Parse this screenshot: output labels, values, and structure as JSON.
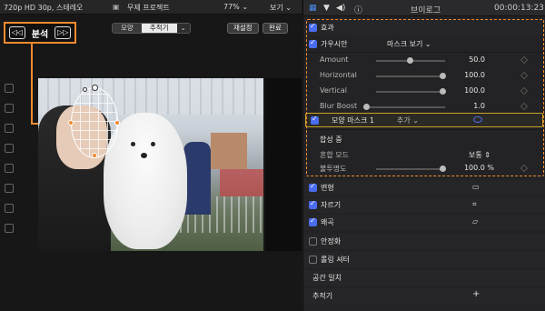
{
  "viewer": {
    "format": "720p HD 30p, 스테레오",
    "project": "무제 프로젝트",
    "zoom": "77%",
    "view": "보기",
    "segments": [
      "모양",
      "추적기"
    ],
    "active_segment": "추적기",
    "reset": "재설정",
    "done": "완료"
  },
  "analyze": {
    "back": "◁◁",
    "label": "분석",
    "forward": "▷▷"
  },
  "inspector": {
    "title": "브이로그",
    "timecode": "00:00:13:23",
    "effects_header": "효과",
    "gaussian": {
      "name": "가우시안",
      "mask_view": "마스크 보기"
    },
    "params": [
      {
        "label": "Amount",
        "value": "50.0",
        "level": 0.5
      },
      {
        "label": "Horizontal",
        "value": "100.0",
        "level": 1.0
      },
      {
        "label": "Vertical",
        "value": "100.0",
        "level": 1.0
      },
      {
        "label": "Blur Boost",
        "value": "1.0",
        "level": 0.05
      }
    ],
    "shape_mask": {
      "label": "모양 마스크 1",
      "add": "추가"
    },
    "composite": {
      "header": "합성 중",
      "blend_label": "혼합 모드",
      "blend_value": "보통",
      "opacity_label": "불투명도",
      "opacity_value": "100.0 %",
      "opacity_level": 1.0
    },
    "sections": [
      {
        "label": "변형",
        "checked": true,
        "icon": "transform-icon"
      },
      {
        "label": "자르기",
        "checked": true,
        "icon": "crop-icon"
      },
      {
        "label": "왜곡",
        "checked": true,
        "icon": "distort-icon"
      },
      {
        "label": "안정화",
        "checked": false
      },
      {
        "label": "롤링 셔터",
        "checked": false
      },
      {
        "label": "공간 일치",
        "checked": null
      },
      {
        "label": "추적기",
        "checked": null,
        "add": "+"
      }
    ]
  },
  "colors": {
    "accent": "#f28a2e",
    "check": "#4a6cf0",
    "mask_icon": "#4a6cf0"
  }
}
